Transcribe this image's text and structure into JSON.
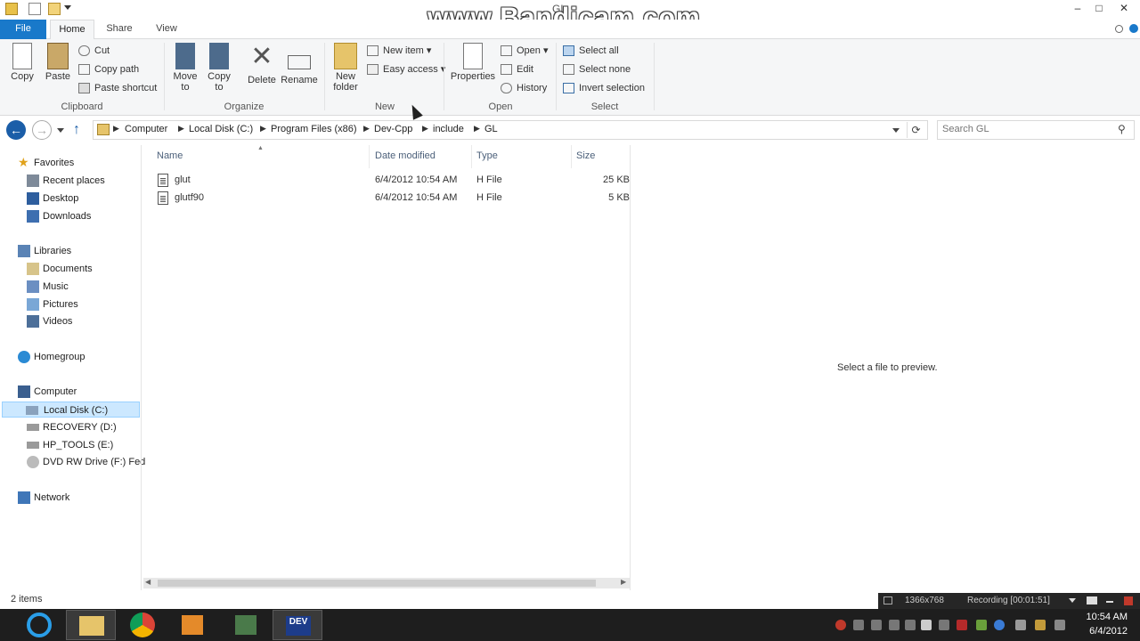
{
  "window": {
    "title": "GL",
    "watermark": "www.Bandicam.com",
    "controls": {
      "minimize": "–",
      "maximize": "□",
      "close": "✕"
    }
  },
  "ribbon": {
    "tabs": [
      {
        "label": "File",
        "active": false
      },
      {
        "label": "Home",
        "active": true
      },
      {
        "label": "Share",
        "active": false
      },
      {
        "label": "View",
        "active": false
      }
    ],
    "clipboard": {
      "label": "Clipboard",
      "copy": "Copy",
      "paste": "Paste",
      "cut": "Cut",
      "copy_path": "Copy path",
      "paste_shortcut": "Paste shortcut"
    },
    "organize": {
      "label": "Organize",
      "move_to": "Move to",
      "copy_to": "Copy to",
      "delete": "Delete",
      "rename": "Rename"
    },
    "new": {
      "label": "New",
      "new_folder": "New folder",
      "new_item": "New item",
      "easy_access": "Easy access"
    },
    "open": {
      "label": "Open",
      "properties": "Properties",
      "open": "Open",
      "edit": "Edit",
      "history": "History"
    },
    "select": {
      "label": "Select",
      "select_all": "Select all",
      "select_none": "Select none",
      "invert_selection": "Invert selection"
    }
  },
  "address": {
    "breadcrumbs": [
      "Computer",
      "Local Disk (C:)",
      "Program Files (x86)",
      "Dev-Cpp",
      "include",
      "GL"
    ]
  },
  "search": {
    "placeholder": "Search GL"
  },
  "nav": {
    "favorites": "Favorites",
    "recent_places": "Recent places",
    "desktop": "Desktop",
    "downloads": "Downloads",
    "libraries": "Libraries",
    "documents": "Documents",
    "music": "Music",
    "pictures": "Pictures",
    "videos": "Videos",
    "homegroup": "Homegroup",
    "computer": "Computer",
    "local_disk": "Local Disk (C:)",
    "recovery": "RECOVERY (D:)",
    "hp_tools": "HP_TOOLS (E:)",
    "dvd": "DVD RW Drive (F:) Fed",
    "network": "Network"
  },
  "filelist": {
    "columns": {
      "name": "Name",
      "date": "Date modified",
      "type": "Type",
      "size": "Size"
    },
    "rows": [
      {
        "name": "glut",
        "date": "6/4/2012 10:54 AM",
        "type": "H File",
        "size": "25 KB"
      },
      {
        "name": "glutf90",
        "date": "6/4/2012 10:54 AM",
        "type": "H File",
        "size": "5 KB"
      }
    ]
  },
  "preview": {
    "message": "Select a file to preview."
  },
  "status": {
    "items": "2 items"
  },
  "recording": {
    "resolution": "1366x768",
    "status": "Recording [00:01:51]"
  },
  "clock": {
    "time": "10:54 AM",
    "date": "6/4/2012"
  },
  "taskbar": {
    "dev_label": "DEV"
  }
}
